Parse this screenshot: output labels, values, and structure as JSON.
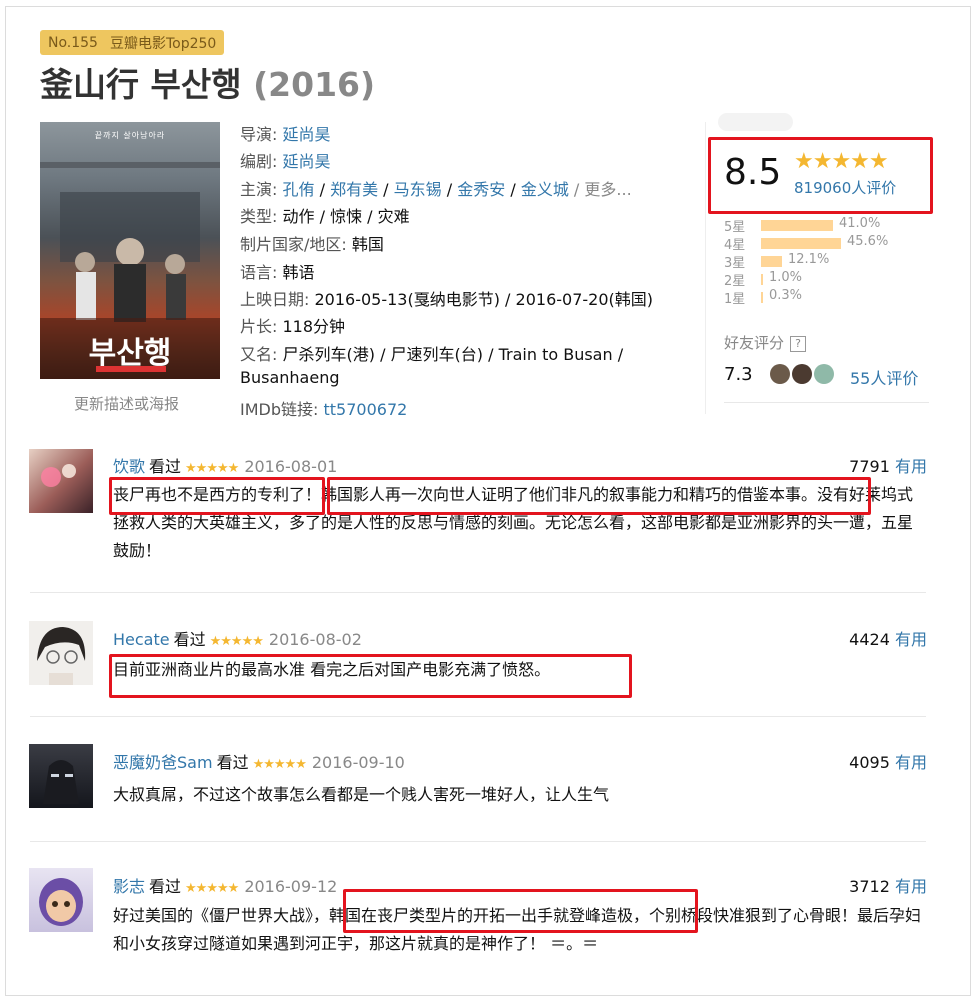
{
  "header": {
    "rank": "No.155",
    "list_name": "豆瓣电影Top250",
    "title": "釜山行 부산행",
    "year": "(2016)"
  },
  "poster": {
    "tagline": "끝까지 살아남아라",
    "title": "부산행",
    "update_link": "更新描述或海报"
  },
  "info": {
    "director_label": "导演:",
    "director": "延尚昊",
    "writer_label": "编剧:",
    "writer": "延尚昊",
    "cast_label": "主演:",
    "cast": [
      "孔侑",
      "郑有美",
      "马东锡",
      "金秀安",
      "金义城"
    ],
    "cast_sep": " / ",
    "cast_more": "/ 更多...",
    "genre_label": "类型:",
    "genre": "动作 / 惊悚 / 灾难",
    "country_label": "制片国家/地区:",
    "country": "韩国",
    "language_label": "语言:",
    "language": "韩语",
    "release_label": "上映日期:",
    "release": "2016-05-13(戛纳电影节) / 2016-07-20(韩国)",
    "runtime_label": "片长:",
    "runtime": "118分钟",
    "aka_label": "又名:",
    "aka_line1": "尸杀列车(港) / 尸速列车(台) / Train to Busan /",
    "aka_line2": "Busanhaeng",
    "imdb_label": "IMDb链接:",
    "imdb": "tt5700672"
  },
  "rating": {
    "score": "8.5",
    "stars": "★★★★★",
    "votes": "819060人评价",
    "histogram": [
      {
        "label": "5星",
        "pct": "41.0%",
        "value": 41.0
      },
      {
        "label": "4星",
        "pct": "45.6%",
        "value": 45.6
      },
      {
        "label": "3星",
        "pct": "12.1%",
        "value": 12.1
      },
      {
        "label": "2星",
        "pct": "1.0%",
        "value": 1.0
      },
      {
        "label": "1星",
        "pct": "0.3%",
        "value": 0.3
      }
    ],
    "friend_label": "好友评分",
    "friend_help": "?",
    "friend_score": "7.3",
    "friend_count": "55人评价"
  },
  "reviews": [
    {
      "user": "饮歌",
      "watched": "看过",
      "stars": "★★★★★",
      "date": "2016-08-01",
      "useful_count": "7791",
      "useful_label": "有用",
      "text": "丧尸再也不是西方的专利了！韩国影人再一次向世人证明了他们非凡的叙事能力和精巧的借鉴本事。没有好莱坞式拯救人类的大英雄主义，多了的是人性的反思与情感的刻画。无论怎么看，这部电影都是亚洲影界的头一遭，五星鼓励！"
    },
    {
      "user": "Hecate",
      "watched": "看过",
      "stars": "★★★★★",
      "date": "2016-08-02",
      "useful_count": "4424",
      "useful_label": "有用",
      "text": "目前亚洲商业片的最高水准 看完之后对国产电影充满了愤怒。"
    },
    {
      "user": "恶魔奶爸Sam",
      "watched": "看过",
      "stars": "★★★★★",
      "date": "2016-09-10",
      "useful_count": "4095",
      "useful_label": "有用",
      "text": "大叔真屌，不过这个故事怎么看都是一个贱人害死一堆好人，让人生气"
    },
    {
      "user": "影志",
      "watched": "看过",
      "stars": "★★★★★",
      "date": "2016-09-12",
      "useful_count": "3712",
      "useful_label": "有用",
      "text": "好过美国的《僵尸世界大战》，韩国在丧尸类型片的开拓一出手就登峰造极，个别桥段快准狠到了心骨眼！最后孕妇和小女孩穿过隧道如果遇到河正宇，那这片就真的是神作了！ ＝。＝"
    }
  ],
  "colors": {
    "link": "#3377aa",
    "star": "#f4b731",
    "highlight": "#e3141e",
    "badge": "#eec65f",
    "bar": "#ffd596"
  }
}
